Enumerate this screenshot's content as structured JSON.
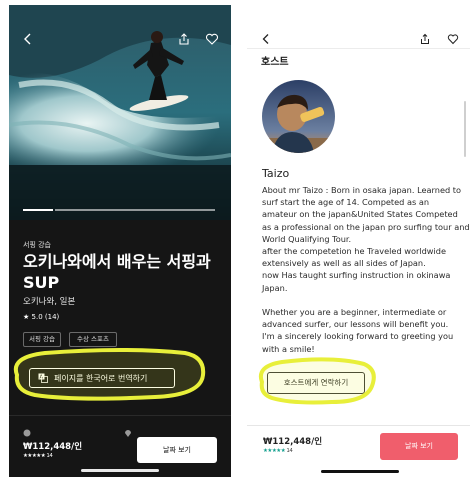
{
  "left_screen": {
    "category": "서핑 강습",
    "title": "오키나와에서 배우는 서핑과 SUP",
    "location": "오키나와, 일본",
    "rating": "5.0",
    "reviews": "(14)",
    "chips": [
      "서핑 강습",
      "수상 스포츠"
    ],
    "translate_button": "페이지를 한국어로 번역하기",
    "price": "₩112,448/인",
    "stars": "★★★★★",
    "review_count": "14",
    "book_button": "날짜 보기",
    "icons": {
      "back": "chevron-left-icon",
      "share": "share-icon",
      "save": "heart-icon",
      "translate": "translate-icon",
      "clock": "clock-icon",
      "pin": "map-pin-icon"
    }
  },
  "right_screen": {
    "section_heading": "호스트",
    "host_name": "Taizo",
    "bio_lines": [
      "About mr Taizo : Born in osaka japan. Learned to",
      "surf  start  the age of 14. Competed as an",
      "amateur on the japan&United States   Competed",
      "as a professional on the japan pro surfing tour and",
      "World Qualifying Tour.",
      "after the competetion he  Traveled worldwide",
      "extensively as well as all sides of Japan.",
      "now Has taught surfing instruction in okinawa",
      "Japan.",
      "",
      "Whether you are a beginner, intermediate or",
      "advanced surfer, our lessons will benefit you.",
      "I'm a sincerely looking forward to greeting you",
      "with a smile!"
    ],
    "contact_button": "호스트에게 연락하기",
    "price": "₩112,448/인",
    "stars": "★★★★★",
    "review_count": "14",
    "book_button": "날짜 보기",
    "icons": {
      "back": "chevron-left-icon",
      "share": "share-icon",
      "save": "heart-icon"
    }
  },
  "colors": {
    "dark_bg": "#151515",
    "brand_pink": "#f05e6c",
    "star_teal": "#15a08f",
    "highlight_yellow": "#e8ef3a"
  }
}
